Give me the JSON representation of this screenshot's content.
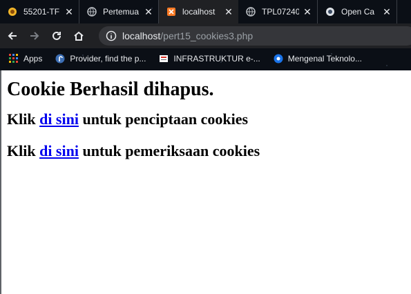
{
  "browser": {
    "tabs": [
      {
        "title": "55201-TF",
        "icon": "fox-icon",
        "active": false
      },
      {
        "title": "Pertemua",
        "icon": "globe-icon",
        "active": false
      },
      {
        "title": "localhost",
        "icon": "xampp-icon",
        "active": true
      },
      {
        "title": "TPL07240",
        "icon": "globe-icon",
        "active": false
      },
      {
        "title": "Open Ca",
        "icon": "open-logo-icon",
        "active": false
      }
    ],
    "url_host": "localhost",
    "url_path": "/pert15_cookies3.php",
    "bookmarks": [
      {
        "label": "Apps",
        "icon": "apps-grid-icon"
      },
      {
        "label": "Provider, find the p...",
        "icon": "fedora-icon"
      },
      {
        "label": "INFRASTRUKTUR e-...",
        "icon": "doc-icon"
      },
      {
        "label": "Mengenal Teknolo...",
        "icon": "blue-badge-icon"
      }
    ]
  },
  "page": {
    "heading": "Cookie Berhasil dihapus.",
    "line1": {
      "prefix": "Klik ",
      "link": "di sini",
      "suffix": " untuk penciptaan cookies"
    },
    "line2": {
      "prefix": "Klik ",
      "link": "di sini",
      "suffix": " untuk pemeriksaan cookies"
    }
  },
  "colors": {
    "link": "#0000ee",
    "chrome_bg": "#202124"
  }
}
